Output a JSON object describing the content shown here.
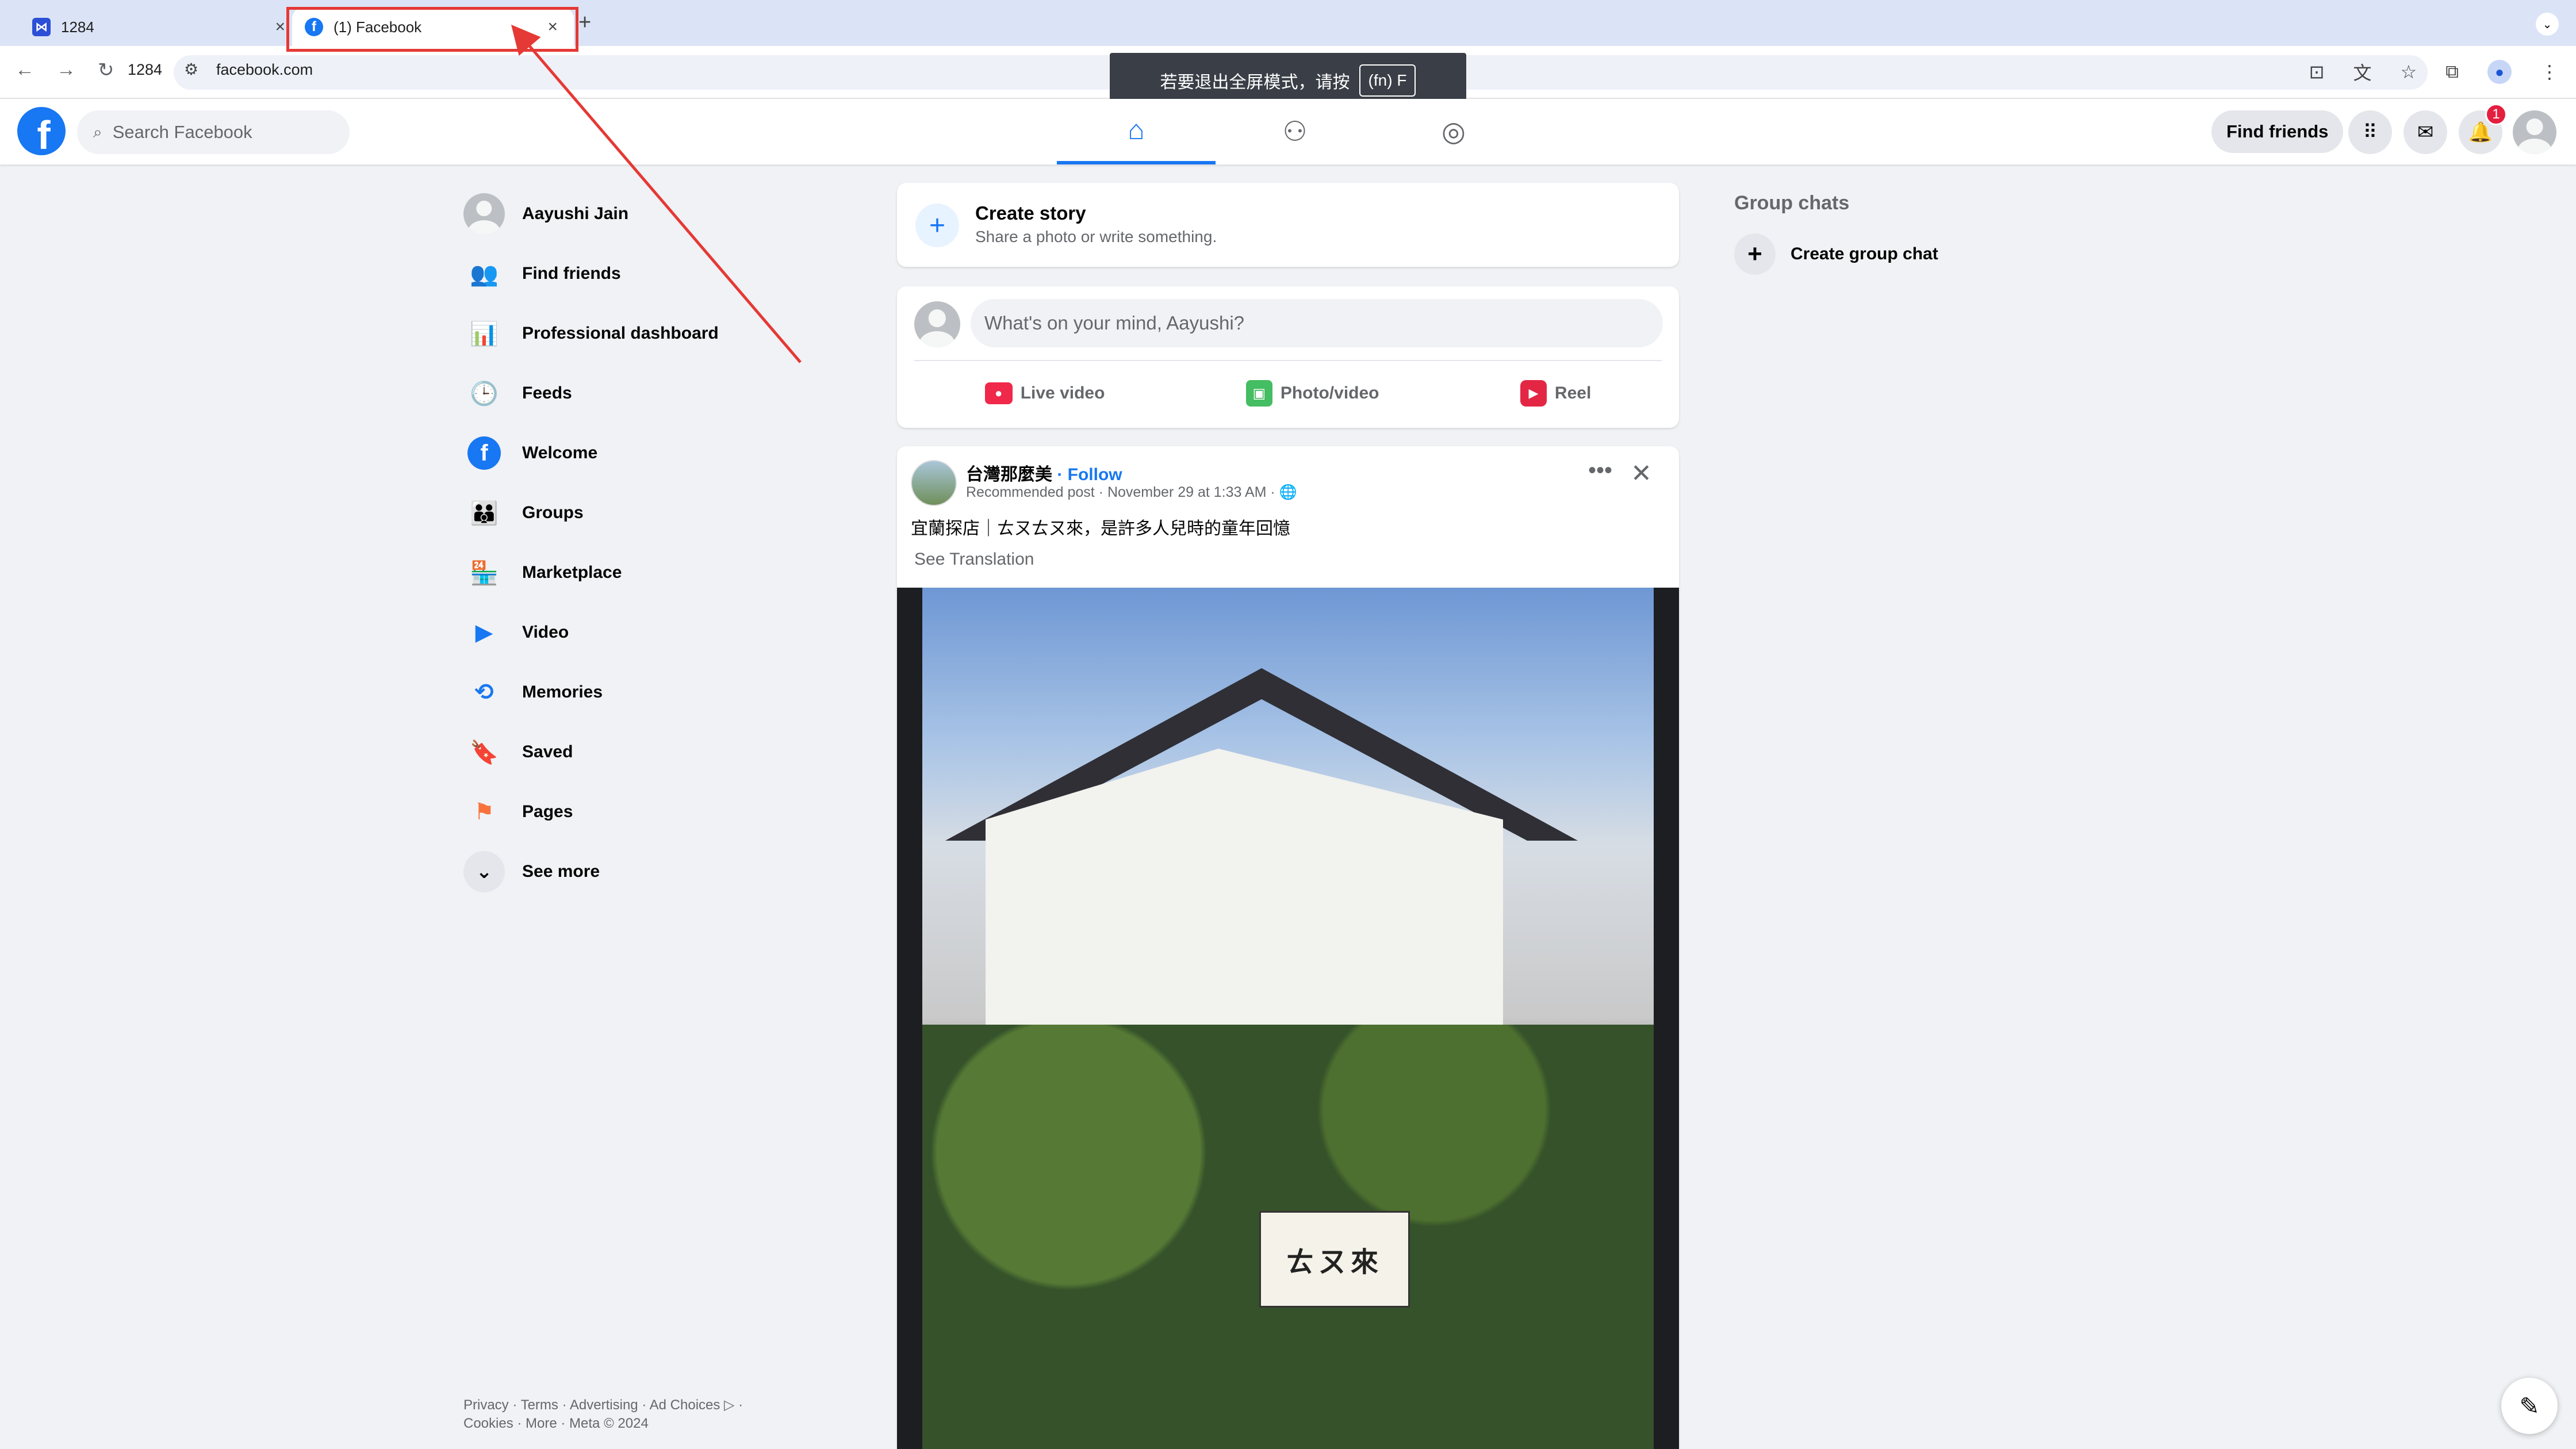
{
  "browser": {
    "tabs": [
      {
        "label": "1284",
        "favicon": "app-icon",
        "close": "×"
      },
      {
        "label": "(1) Facebook",
        "favicon": "facebook-icon",
        "close": "×"
      }
    ],
    "new_tab": "+",
    "omnibox_tab_label": "1284",
    "url": "facebook.com",
    "fullscreen_hint": {
      "text": "若要退出全屏模式，请按",
      "key": "(fn) F"
    },
    "annotation_color": "#e53935"
  },
  "header": {
    "logo": "f",
    "search_placeholder": "Search Facebook",
    "find_friends": "Find friends",
    "notification_count": "1",
    "nav": [
      "home-icon",
      "friends-icon",
      "groups-icon"
    ]
  },
  "sidebar": {
    "items": [
      {
        "label": "Aayushi Jain",
        "icon": "avatar"
      },
      {
        "label": "Find friends",
        "icon": "friends-icon"
      },
      {
        "label": "Professional dashboard",
        "icon": "dashboard-icon"
      },
      {
        "label": "Feeds",
        "icon": "feeds-icon"
      },
      {
        "label": "Welcome",
        "icon": "facebook-icon"
      },
      {
        "label": "Groups",
        "icon": "groups-icon"
      },
      {
        "label": "Marketplace",
        "icon": "marketplace-icon"
      },
      {
        "label": "Video",
        "icon": "video-icon"
      },
      {
        "label": "Memories",
        "icon": "memories-icon"
      },
      {
        "label": "Saved",
        "icon": "saved-icon"
      },
      {
        "label": "Pages",
        "icon": "pages-icon"
      },
      {
        "label": "See more",
        "icon": "chevron-down-icon"
      }
    ],
    "footer": {
      "line1": "Privacy · Terms · Advertising · Ad Choices ▷ ·",
      "line2": "Cookies · More · Meta © 2024"
    }
  },
  "feed": {
    "story": {
      "title": "Create story",
      "subtitle": "Share a photo or write something."
    },
    "composer": {
      "placeholder": "What's on your mind, Aayushi?",
      "actions": [
        "Live video",
        "Photo/video",
        "Reel"
      ]
    },
    "post": {
      "author": "台灣那麼美",
      "follow": " · Follow",
      "meta": "Recommended post · November 29 at 1:33 AM · 🌐",
      "text": "宜蘭探店｜ㄊㄡㄊㄡ來，是許多人兒時的童年回憶",
      "see_translation": "See Translation",
      "banner_text": "ㄊㄡ來"
    }
  },
  "right": {
    "group_chats": "Group chats",
    "create_group_chat": "Create group chat"
  },
  "colors": {
    "brand": "#1877f2",
    "background": "#f0f2f5",
    "badge": "#e41e3f"
  }
}
